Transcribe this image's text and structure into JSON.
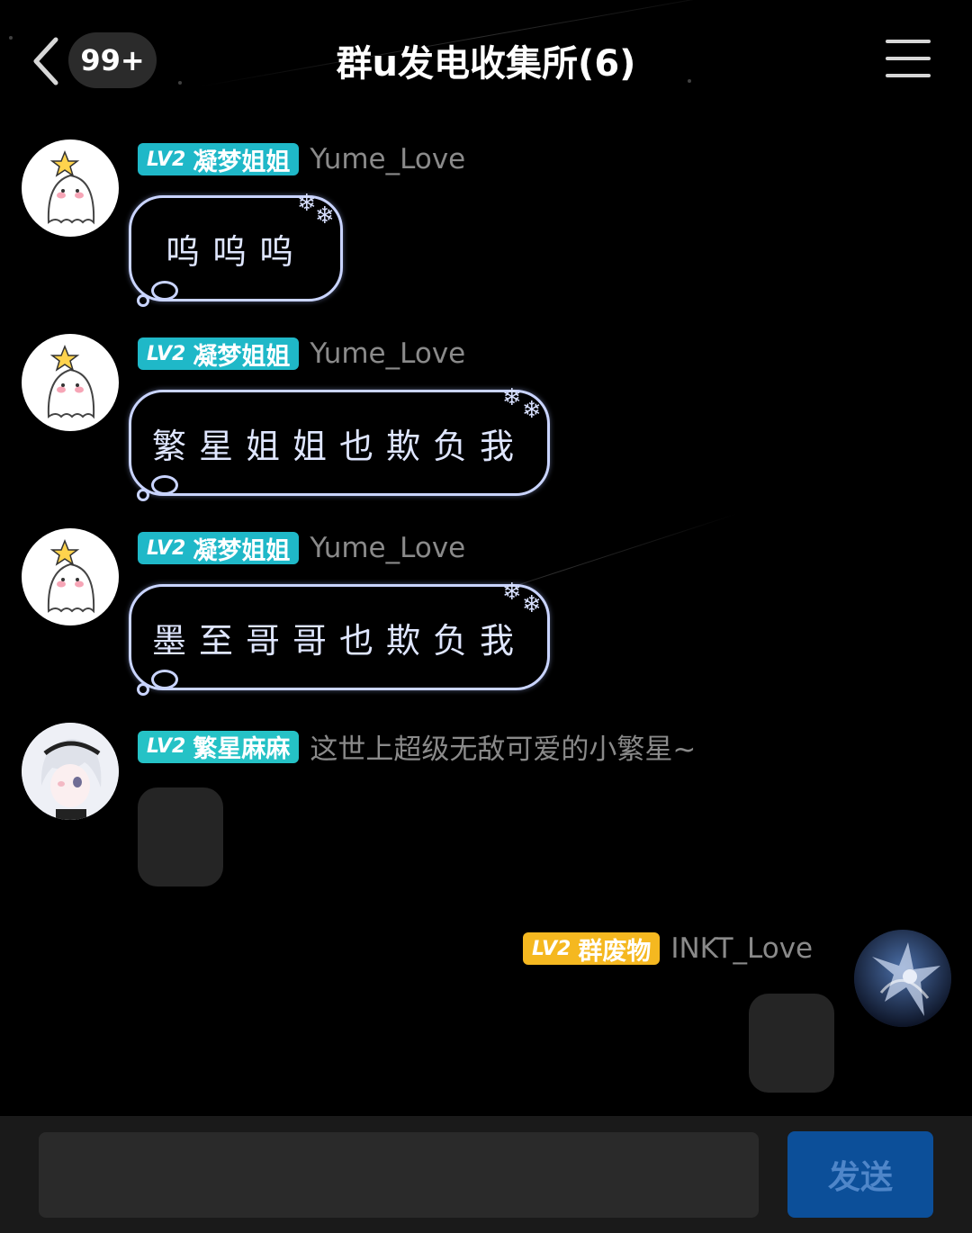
{
  "header": {
    "unread_badge": "99+",
    "title": "群u发电收集所(6)"
  },
  "messages": [
    {
      "level": "LV2",
      "title_tag": "凝梦姐姐",
      "tag_color": "#1fb8c8",
      "nickname": "Yume_Love",
      "text": "呜呜呜"
    },
    {
      "level": "LV2",
      "title_tag": "凝梦姐姐",
      "tag_color": "#1fb8c8",
      "nickname": "Yume_Love",
      "text": "繁星姐姐也欺负我"
    },
    {
      "level": "LV2",
      "title_tag": "凝梦姐姐",
      "tag_color": "#1fb8c8",
      "nickname": "Yume_Love",
      "text": "墨至哥哥也欺负我"
    },
    {
      "level": "LV2",
      "title_tag": "繁星麻麻",
      "tag_color": "#25c2c6",
      "nickname": "这世上超级无敌可爱的小繁星~"
    },
    {
      "level": "LV2",
      "title_tag": "群废物",
      "tag_color": "#f5b820",
      "nickname": "INKT_Love"
    }
  ],
  "composer": {
    "input_value": "",
    "send_label": "发送"
  },
  "colors": {
    "background": "#000000",
    "bottom_bar": "#1a1a1a",
    "send_button": "#0c4f99",
    "bubble_outline": "#c9d4ff"
  },
  "icons": {
    "back": "chevron-left-icon",
    "menu": "hamburger-menu-icon",
    "decor": "snowflake-icon"
  }
}
